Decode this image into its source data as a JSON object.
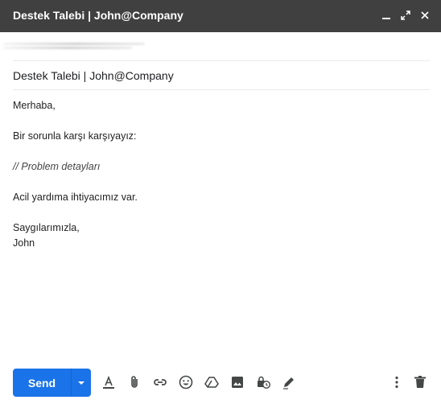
{
  "header": {
    "title": "Destek Talebi | John@Company",
    "minimize_icon": "minimize-icon",
    "expand_icon": "expand-icon",
    "close_icon": "close-icon"
  },
  "compose": {
    "subject": "Destek Talebi | John@Company",
    "body": {
      "greeting": "Merhaba,",
      "line1": "Bir sorunla karşı karşıyayız:",
      "line2": "// Problem detayları",
      "line3": "Acil yardıma ihtiyacımız var.",
      "closing": "Saygılarımızla,",
      "signature": "John"
    }
  },
  "toolbar": {
    "send_label": "Send",
    "icons": [
      "formatting-icon",
      "attach-icon",
      "link-icon",
      "emoji-icon",
      "drive-icon",
      "photo-icon",
      "confidential-icon",
      "signature-icon",
      "more-options-icon",
      "delete-icon"
    ]
  },
  "colors": {
    "header_bg": "#404040",
    "send_button": "#1a73e8",
    "icon": "#444746"
  }
}
